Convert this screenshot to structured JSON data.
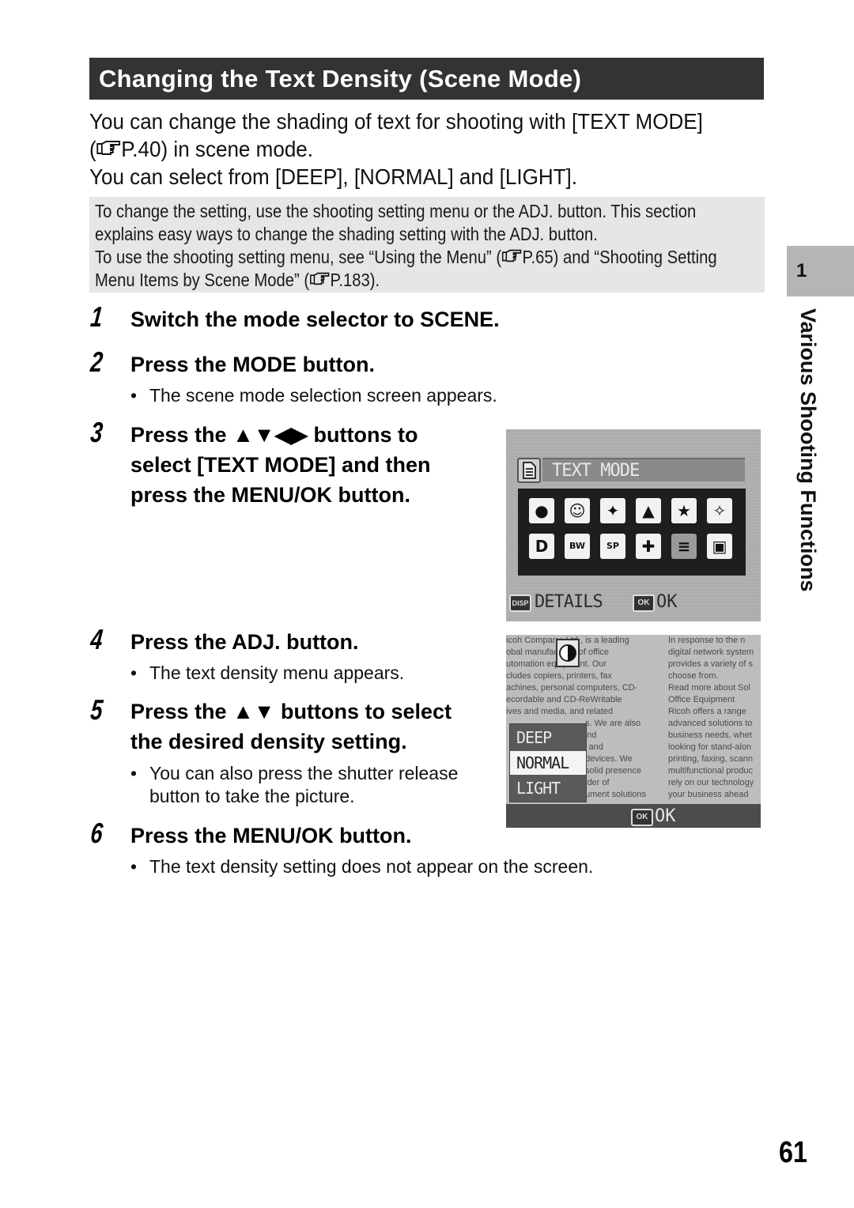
{
  "section": {
    "title": "Changing the Text Density (Scene Mode)"
  },
  "intro": {
    "line1": "You can change the shading of text for shooting with [TEXT MODE]",
    "line2_pre": "(",
    "line2_ref": "P.40",
    "line2_post": ") in scene mode.",
    "line3": "You can select from [DEEP], [NORMAL] and [LIGHT]."
  },
  "note": {
    "line1": "To change the setting, use the shooting setting menu or the ADJ. button. This section",
    "line2": "explains easy ways to change the shading setting with the ADJ. button.",
    "line3_pre": "To use the shooting setting menu, see “Using the Menu” (",
    "line3_ref": "P.65",
    "line3_post": ") and “Shooting Setting",
    "line4_pre": "Menu Items by Scene Mode” (",
    "line4_ref": "P.183",
    "line4_post": ")."
  },
  "steps": [
    {
      "number": "1",
      "title_lines": [
        "Switch the mode selector to SCENE."
      ],
      "bullets": []
    },
    {
      "number": "2",
      "title_lines": [
        "Press the MODE button."
      ],
      "bullets": [
        "The scene mode selection screen appears."
      ]
    },
    {
      "number": "3",
      "title_lines": [
        "Press the ▲▼◀▶ buttons to",
        "select [TEXT MODE] and then",
        "press the MENU/OK button."
      ],
      "bullets": []
    },
    {
      "number": "4",
      "title_lines": [
        "Press the ADJ. button."
      ],
      "bullets": [
        "The text density menu appears."
      ]
    },
    {
      "number": "5",
      "title_lines": [
        "Press the ▲▼ buttons to select",
        "the desired density setting."
      ],
      "bullets": [
        "You can also press the shutter release",
        "button to take the picture."
      ]
    },
    {
      "number": "6",
      "title_lines": [
        "Press the MENU/OK button."
      ],
      "bullets": [
        "The text density setting does not appear on the screen."
      ]
    }
  ],
  "screen1": {
    "mode_title": "TEXT MODE",
    "icons_row1": [
      "portrait-icon",
      "face-icon",
      "sports-icon",
      "landscape-icon",
      "nightscape-icon",
      "high-sensitivity-icon"
    ],
    "icons_row2": [
      "zoom-macro-icon",
      "skew-correction-bw-icon",
      "skew-correction-sepia-icon",
      "fireworks-icon",
      "text-mode-icon",
      "movie-icon"
    ],
    "selected_icon": "text-mode-icon",
    "footer_disp_key": "DISP",
    "footer_details": "DETAILS",
    "footer_ok_key": "OK",
    "footer_ok": "OK"
  },
  "screen2": {
    "doc_left": [
      "icoh Company, Ltd., is a leading",
      "obal manufacturer of office",
      "utomation equipment. Our",
      "cludes copiers, printers, fax",
      "achines, personal computers, CD-",
      "ecordable and CD-ReWritable",
      "ives and media, and related",
      "s. We are also",
      "and",
      "s and",
      "devices. We",
      "solid presence",
      "ider of",
      "ument solutions"
    ],
    "doc_right": [
      "In response to the n",
      "digital network system",
      "provides a variety of s",
      "choose from.",
      "Read more about Sol",
      "Office Equipment",
      "Ricoh offers a range",
      "advanced solutions to",
      "business needs, whet",
      "looking for stand-alon",
      "printing, faxing, scann",
      "multifunctional produc",
      "rely on our technology",
      "your business ahead"
    ],
    "menu_options": [
      "DEEP",
      "NORMAL",
      "LIGHT"
    ],
    "selected_option": "NORMAL",
    "footer_ok_key": "OK",
    "footer_ok": "OK"
  },
  "sidebar": {
    "chapter_number": "1",
    "chapter_title": "Various Shooting Functions"
  },
  "page_number": "61"
}
